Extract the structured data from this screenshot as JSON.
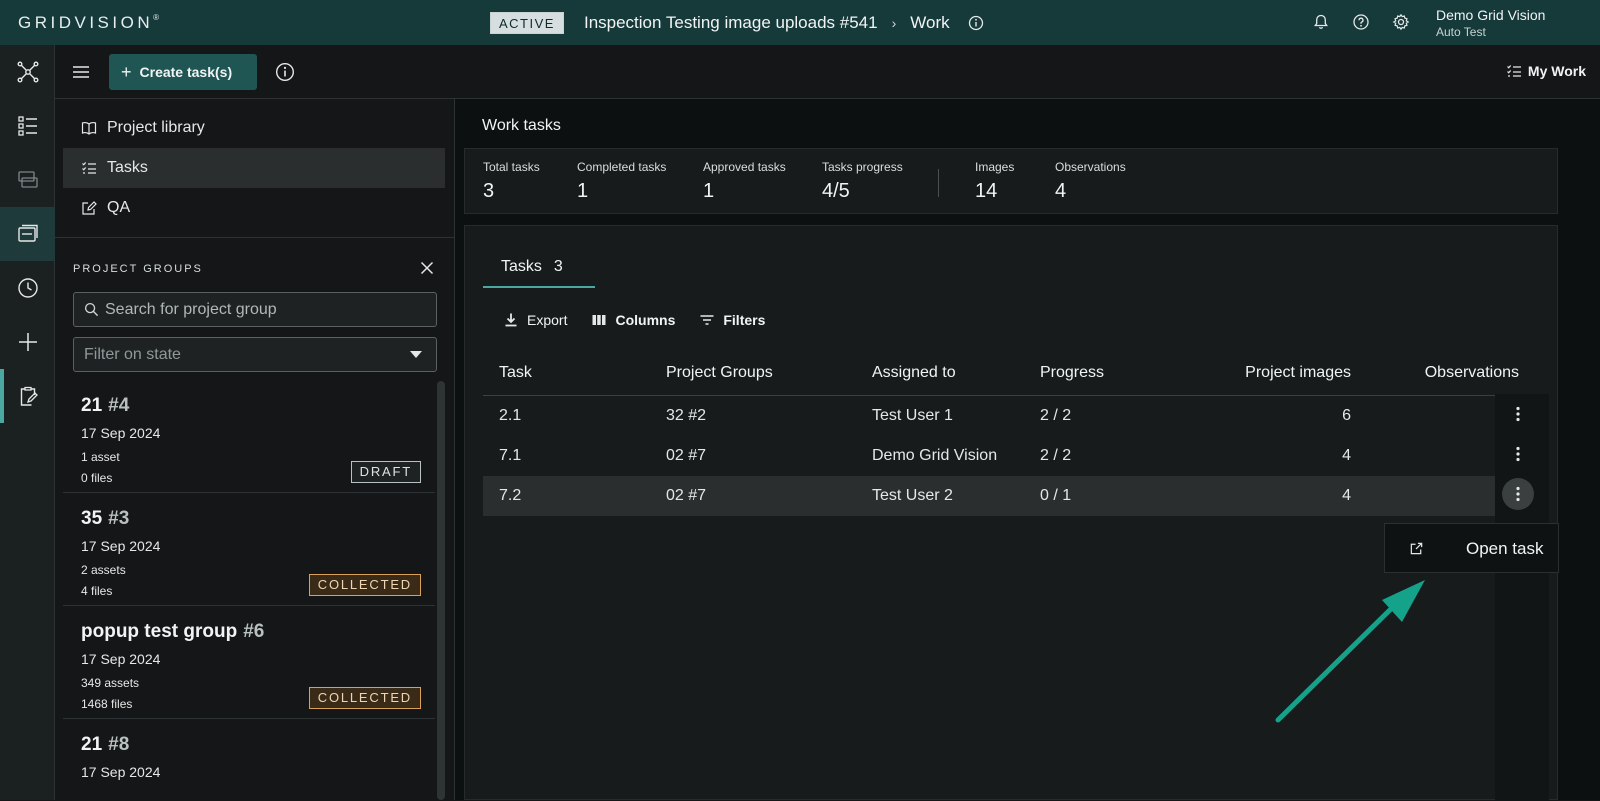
{
  "topbar": {
    "logo": "GRIDVISION",
    "logo_mark": "®",
    "status_badge": "ACTIVE",
    "project_title": "Inspection Testing image uploads  #541",
    "breadcrumb_sep": "›",
    "page": "Work",
    "user_name": "Demo Grid Vision",
    "user_org": "Auto Test"
  },
  "toolbar": {
    "create_label": "Create task(s)",
    "create_plus": "+",
    "mywork_label": "My Work"
  },
  "leftnav": {
    "items": [
      {
        "label": "Project library"
      },
      {
        "label": "Tasks"
      },
      {
        "label": "QA"
      }
    ]
  },
  "project_groups": {
    "heading": "PROJECT GROUPS",
    "search_placeholder": "Search for project group",
    "filter_placeholder": "Filter on state",
    "groups": [
      {
        "name": "21",
        "num": "#4",
        "date": "17 Sep 2024",
        "assets": "1 asset",
        "files": "0 files",
        "state": "DRAFT"
      },
      {
        "name": "35",
        "num": "#3",
        "date": "17 Sep 2024",
        "assets": "2 assets",
        "files": "4 files",
        "state": "COLLECTED"
      },
      {
        "name": "popup test group",
        "num": "#6",
        "date": "17 Sep 2024",
        "assets": "349 assets",
        "files": "1468 files",
        "state": "COLLECTED"
      },
      {
        "name": "21",
        "num": "#8",
        "date": "17 Sep 2024"
      }
    ]
  },
  "work": {
    "title": "Work tasks",
    "stats": [
      {
        "label": "Total tasks",
        "value": "3"
      },
      {
        "label": "Completed tasks",
        "value": "1"
      },
      {
        "label": "Approved tasks",
        "value": "1"
      },
      {
        "label": "Tasks progress",
        "value": "4/5"
      },
      {
        "label": "Images",
        "value": "14"
      },
      {
        "label": "Observations",
        "value": "4"
      }
    ],
    "tab_label": "Tasks",
    "tab_count": "3",
    "actions": {
      "export": "Export",
      "columns": "Columns",
      "filters": "Filters"
    },
    "columns": [
      "Task",
      "Project Groups",
      "Assigned to",
      "Progress",
      "Project images",
      "Observations"
    ],
    "rows": [
      {
        "task": "2.1",
        "group": "32 #2",
        "assigned": "Test User 1",
        "progress": "2 / 2",
        "images": "6"
      },
      {
        "task": "7.1",
        "group": "02 #7",
        "assigned": "Demo Grid Vision",
        "progress": "2 / 2",
        "images": "4"
      },
      {
        "task": "7.2",
        "group": "02 #7",
        "assigned": "Test User 2",
        "progress": "0 / 1",
        "images": "4"
      }
    ],
    "context_menu": {
      "open_task": "Open task"
    }
  }
}
